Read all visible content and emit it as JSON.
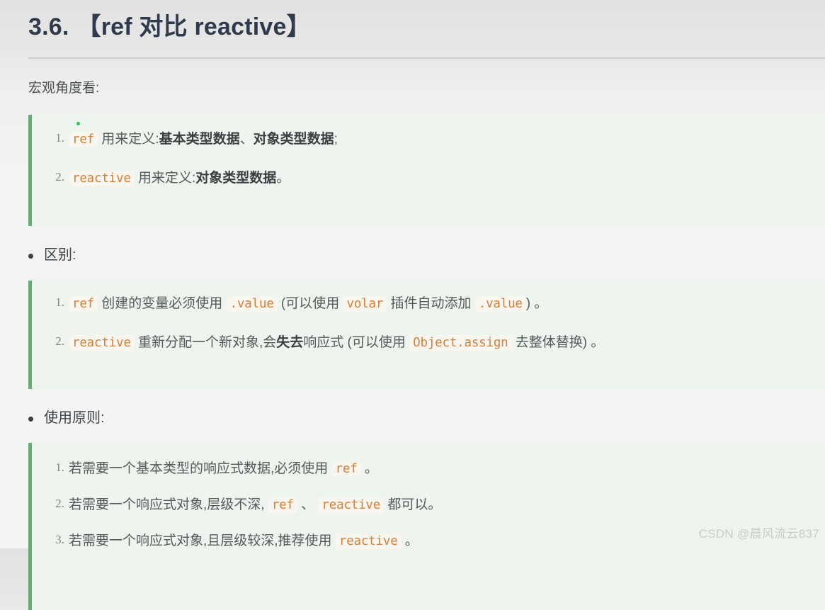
{
  "heading": {
    "number": "3.6.",
    "text": "【ref 对比 reactive】"
  },
  "lead": "宏观角度看:",
  "bullets": [
    {
      "label": "区别:"
    },
    {
      "label": "使用原则:"
    }
  ],
  "blocks": [
    {
      "id": "macro-view",
      "items": [
        {
          "parts": [
            {
              "type": "code",
              "text": "ref"
            },
            {
              "type": "text",
              "text": " 用来定义:"
            },
            {
              "type": "bold",
              "text": "基本类型数据"
            },
            {
              "type": "text",
              "text": "、"
            },
            {
              "type": "bold",
              "text": "对象类型数据"
            },
            {
              "type": "text",
              "text": ";"
            }
          ]
        },
        {
          "parts": [
            {
              "type": "code",
              "text": "reactive"
            },
            {
              "type": "text",
              "text": " 用来定义:"
            },
            {
              "type": "bold",
              "text": "对象类型数据"
            },
            {
              "type": "text",
              "text": "。"
            }
          ]
        }
      ]
    },
    {
      "id": "differences",
      "items": [
        {
          "parts": [
            {
              "type": "code",
              "text": "ref"
            },
            {
              "type": "text",
              "text": " 创建的变量必须使用 "
            },
            {
              "type": "code",
              "text": ".value"
            },
            {
              "type": "text",
              "text": " (可以使用 "
            },
            {
              "type": "code",
              "text": "volar"
            },
            {
              "type": "text",
              "text": " 插件自动添加 "
            },
            {
              "type": "code",
              "text": ".value"
            },
            {
              "type": "text",
              "text": ") 。"
            }
          ]
        },
        {
          "parts": [
            {
              "type": "code",
              "text": "reactive"
            },
            {
              "type": "text",
              "text": " 重新分配一个新对象,会"
            },
            {
              "type": "bold",
              "text": "失去"
            },
            {
              "type": "text",
              "text": "响应式 (可以使用 "
            },
            {
              "type": "code",
              "text": "Object.assign"
            },
            {
              "type": "text",
              "text": " 去整体替换) 。"
            }
          ]
        }
      ]
    },
    {
      "id": "usage-principles",
      "items": [
        {
          "parts": [
            {
              "type": "text",
              "text": "若需要一个基本类型的响应式数据,必须使用 "
            },
            {
              "type": "code",
              "text": "ref"
            },
            {
              "type": "text",
              "text": " 。"
            }
          ]
        },
        {
          "parts": [
            {
              "type": "text",
              "text": "若需要一个响应式对象,层级不深, "
            },
            {
              "type": "code",
              "text": "ref"
            },
            {
              "type": "text",
              "text": " 、 "
            },
            {
              "type": "code",
              "text": "reactive"
            },
            {
              "type": "text",
              "text": " 都可以。"
            }
          ]
        },
        {
          "parts": [
            {
              "type": "text",
              "text": "若需要一个响应式对象,且层级较深,推荐使用 "
            },
            {
              "type": "code",
              "text": "reactive"
            },
            {
              "type": "text",
              "text": " 。"
            }
          ]
        }
      ]
    }
  ],
  "watermark": "CSDN @晨风流云837",
  "colors": {
    "heading": "#2f3b4d",
    "quote_border": "#68ab79",
    "quote_background": "#eef4ee",
    "inline_code": "#d4813a",
    "caret_dot": "#23c552",
    "page_background": "#f1f1f1"
  }
}
